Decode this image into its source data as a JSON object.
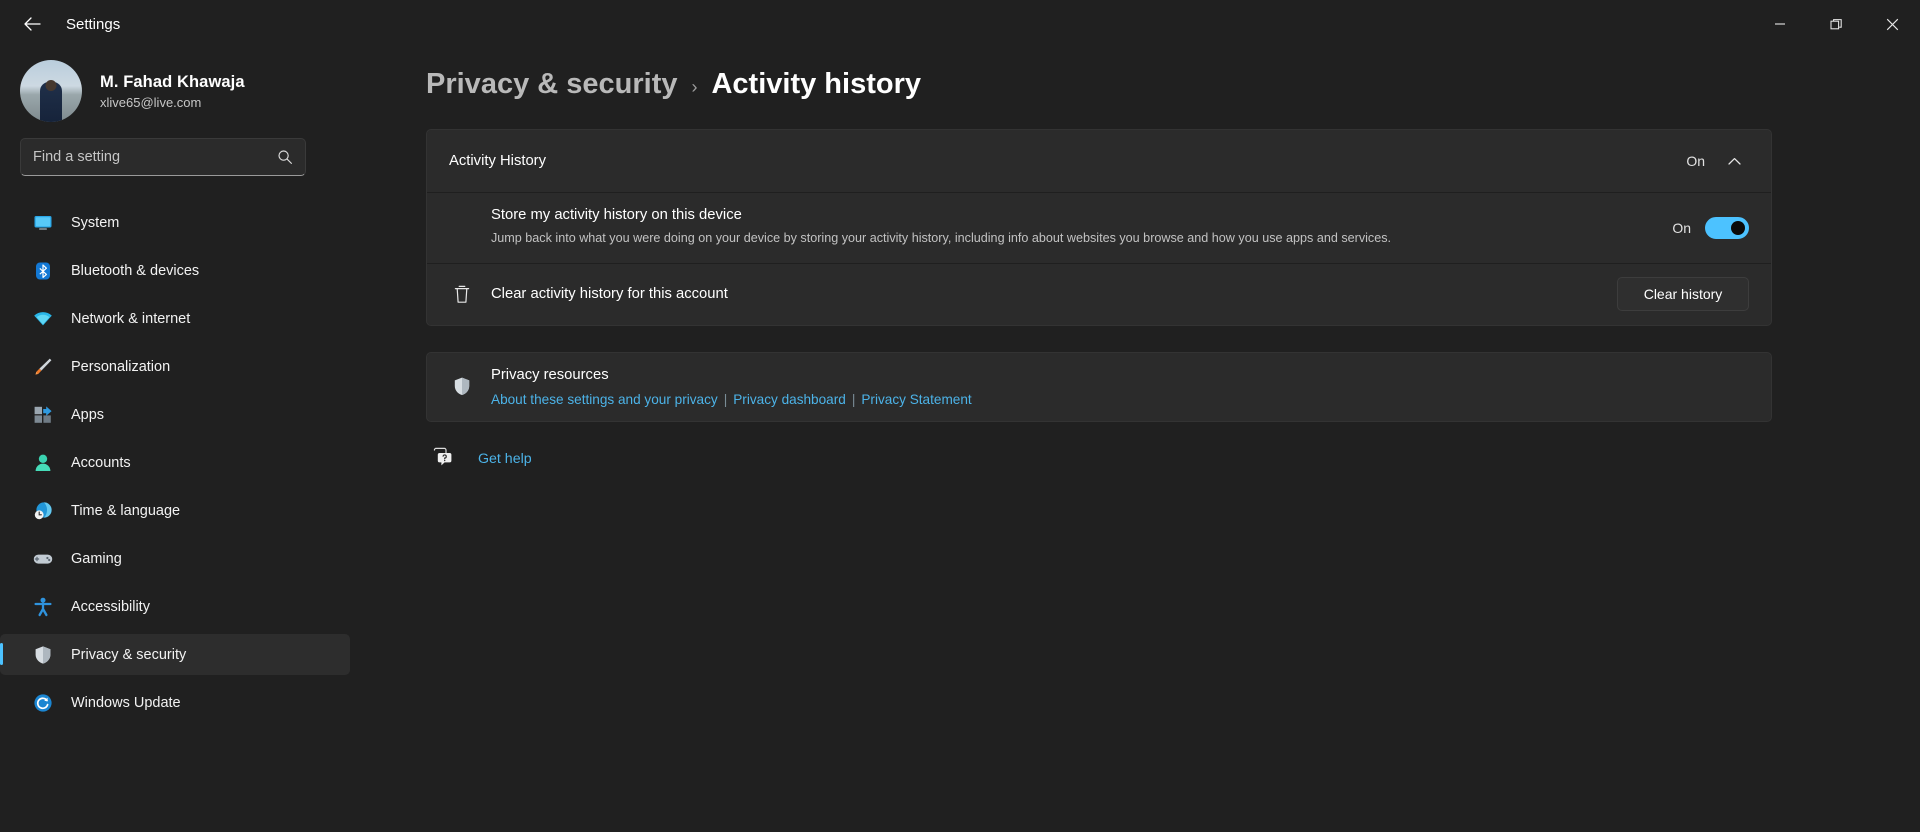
{
  "titlebar": {
    "back_label": "back-arrow",
    "app_title": "Settings",
    "minimize": "minimize",
    "restore": "restore",
    "close": "close"
  },
  "profile": {
    "name": "M. Fahad Khawaja",
    "email": "xlive65@live.com"
  },
  "search": {
    "placeholder": "Find a setting",
    "value": "",
    "icon": "search-icon"
  },
  "sidebar": {
    "items": [
      {
        "label": "System",
        "icon": "system-icon",
        "selected": false
      },
      {
        "label": "Bluetooth & devices",
        "icon": "bluetooth-icon",
        "selected": false
      },
      {
        "label": "Network & internet",
        "icon": "wifi-icon",
        "selected": false
      },
      {
        "label": "Personalization",
        "icon": "paintbrush-icon",
        "selected": false
      },
      {
        "label": "Apps",
        "icon": "apps-icon",
        "selected": false
      },
      {
        "label": "Accounts",
        "icon": "account-icon",
        "selected": false
      },
      {
        "label": "Time & language",
        "icon": "clock-globe-icon",
        "selected": false
      },
      {
        "label": "Gaming",
        "icon": "gamepad-icon",
        "selected": false
      },
      {
        "label": "Accessibility",
        "icon": "accessibility-icon",
        "selected": false
      },
      {
        "label": "Privacy & security",
        "icon": "shield-icon",
        "selected": true
      },
      {
        "label": "Windows Update",
        "icon": "update-icon",
        "selected": false
      }
    ]
  },
  "breadcrumb": {
    "parent": "Privacy & security",
    "separator": "›",
    "current": "Activity history"
  },
  "main": {
    "expander": {
      "title": "Activity History",
      "value": "On",
      "chevron": "chevron-up-icon"
    },
    "store_setting": {
      "title": "Store my activity history on this device",
      "description": "Jump back into what you were doing on your device by storing your activity history, including info about websites you browse and how you use apps and services.",
      "toggle_state": "On"
    },
    "clear_history": {
      "title": "Clear activity history for this account",
      "icon": "trash-icon",
      "button_label": "Clear history"
    },
    "privacy_resources": {
      "title": "Privacy resources",
      "icon": "shield-icon",
      "links": [
        "About these settings and your privacy",
        "Privacy dashboard",
        "Privacy Statement"
      ],
      "separator": "|"
    },
    "get_help": {
      "label": "Get help",
      "icon": "help-icon"
    }
  },
  "colors": {
    "accent": "#4cc2ff",
    "link": "#4cb3e8",
    "page_bg": "#202020",
    "card_bg": "#2b2b2b"
  }
}
